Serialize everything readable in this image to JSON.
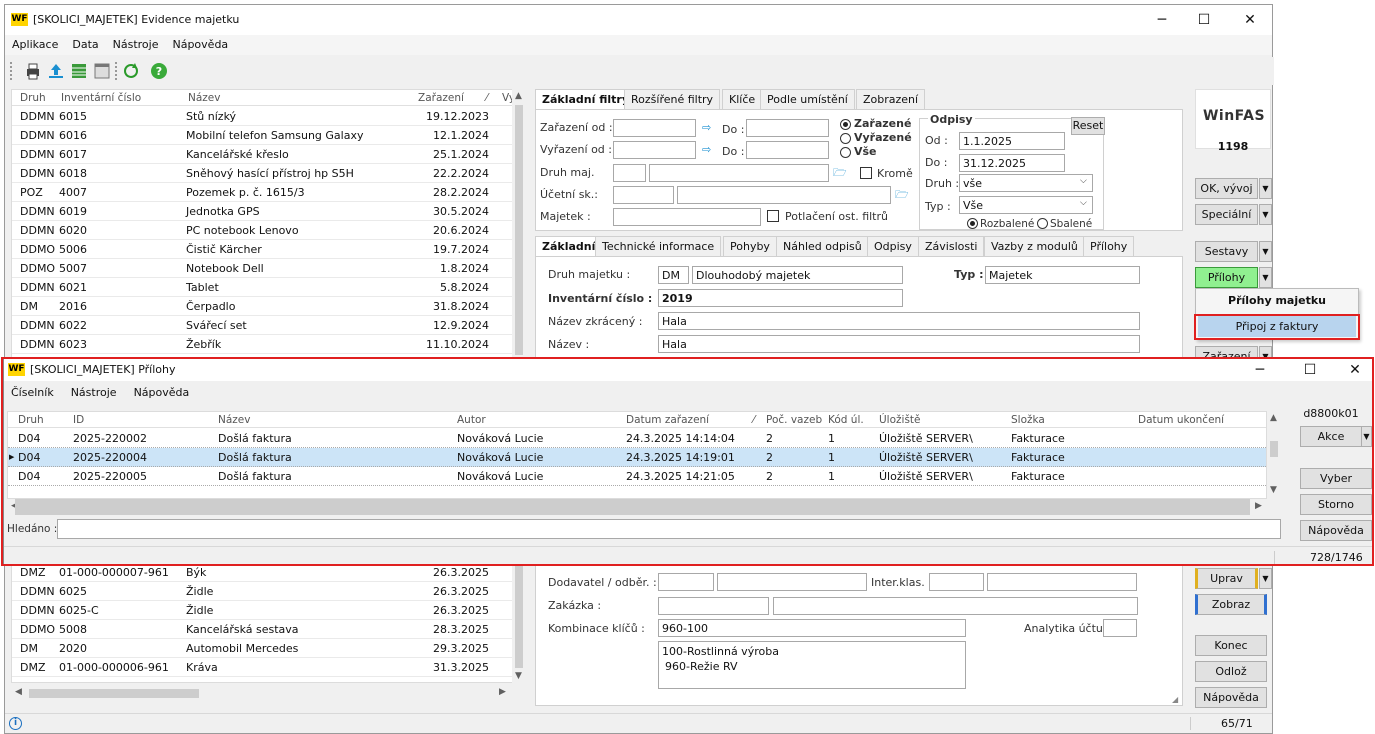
{
  "main": {
    "title": "[SKOLICI_MAJETEK] Evidence majetku",
    "logo_text": "WF",
    "menu": [
      "Aplikace",
      "Data",
      "Nástroje",
      "Nápověda"
    ],
    "grid": {
      "headers": [
        "Druh",
        "Inventární číslo",
        "Název",
        "Zařazení",
        "Vy"
      ],
      "rows_top": [
        [
          "DDMN",
          "6015",
          "Stů nízký",
          "19.12.2023"
        ],
        [
          "DDMN",
          "6016",
          "Mobilní telefon Samsung Galaxy",
          "12.1.2024"
        ],
        [
          "DDMN",
          "6017",
          "Kancelářské křeslo",
          "25.1.2024"
        ],
        [
          "DDMN",
          "6018",
          "Sněhový hasící přístroj hp S5H",
          "22.2.2024"
        ],
        [
          "POZ",
          "4007",
          "Pozemek p. č. 1615/3",
          "28.2.2024"
        ],
        [
          "DDMN",
          "6019",
          "Jednotka GPS",
          "30.5.2024"
        ],
        [
          "DDMN",
          "6020",
          "PC notebook Lenovo",
          "20.6.2024"
        ],
        [
          "DDMO",
          "5006",
          "Čistič Kärcher",
          "19.7.2024"
        ],
        [
          "DDMO",
          "5007",
          "Notebook Dell",
          "1.8.2024"
        ],
        [
          "DDMN",
          "6021",
          "Tablet",
          "5.8.2024"
        ],
        [
          "DM",
          "2016",
          "Čerpadlo",
          "31.8.2024"
        ],
        [
          "DDMN",
          "6022",
          "Svářecí set",
          "12.9.2024"
        ],
        [
          "DDMN",
          "6023",
          "Žebřík",
          "11.10.2024"
        ]
      ],
      "rows_bottom": [
        [
          "DMZ",
          "01-000-000007-961",
          "Býk",
          "26.3.2025"
        ],
        [
          "DDMN",
          "6025",
          "Židle",
          "26.3.2025"
        ],
        [
          "DDMN",
          "6025-C",
          "Židle",
          "26.3.2025"
        ],
        [
          "DDMO",
          "5008",
          "Kancelářská sestava",
          "28.3.2025"
        ],
        [
          "DM",
          "2020",
          "Automobil Mercedes",
          "29.3.2025"
        ],
        [
          "DMZ",
          "01-000-000006-961",
          "Kráva",
          "31.3.2025"
        ]
      ]
    },
    "filter_tabs": [
      "Základní filtry",
      "Rozšířené filtry",
      "Klíče",
      "Podle umístění",
      "Zobrazení"
    ],
    "filters": {
      "zarazeni_od": "Zařazení od :",
      "vyrazeni_od": "Vyřazení od :",
      "do": "Do :",
      "druh_maj": "Druh maj.",
      "ucetni_sk": "Účetní sk.:",
      "majetek": "Majetek :",
      "radio": [
        "Zařazené",
        "Vyřazené",
        "Vše"
      ],
      "krome": "Kromě",
      "potlaceni": "Potlačení ost. filtrů",
      "odpisy_title": "Odpisy",
      "od_label": "Od :",
      "od_value": "1.1.2025",
      "do_label": "Do :",
      "do_value": "31.12.2025",
      "druh_label": "Druh :",
      "druh_value": "vše",
      "typ_label": "Typ :",
      "typ_value": "Vše",
      "reset": "Reset",
      "rozbalene": "Rozbalené",
      "sbalene": "Sbalené"
    },
    "detail_tabs": [
      "Základní",
      "Technické informace",
      "Pohyby",
      "Náhled odpisů",
      "Odpisy",
      "Závislosti",
      "Vazby z modulů",
      "Přílohy"
    ],
    "detail": {
      "druh_label": "Druh majetku :",
      "druh_code": "DM",
      "druh_name": "Dlouhodobý majetek",
      "typ_label": "Typ :",
      "typ_value": "Majetek",
      "inv_label": "Inventární číslo :",
      "inv_value": "2019",
      "nazev_zkr_label": "Název zkrácený :",
      "nazev_zkr_value": "Hala",
      "nazev_label": "Název :",
      "nazev_value": "Hala",
      "dodavatel_label": "Dodavatel / odběr. :",
      "interklas_label": "Inter.klas. :",
      "zakazka_label": "Zakázka :",
      "kombinace_label": "Kombinace klíčů :",
      "kombinace_value": "960-100",
      "kombinace_lines": [
        "100-Rostlinná výroba",
        "960-Režie RV"
      ],
      "analytika_label": "Analytika účtu :"
    },
    "side": {
      "brand": "WinFAS",
      "number": "1198",
      "ok_vyvoj": "OK, vývoj",
      "specialni": "Speciální",
      "sestavy": "Sestavy",
      "prilohy": "Přílohy",
      "zarazeni": "Zařazení",
      "uprav": "Uprav",
      "zobraz": "Zobraz",
      "konec": "Konec",
      "odloz": "Odlož",
      "napoveda": "Nápověda",
      "counter": "65/71"
    },
    "popup": {
      "title": "Přílohy majetku",
      "item": "Připoj z faktury"
    },
    "status_icon": "info-icon"
  },
  "dialog": {
    "title": "[SKOLICI_MAJETEK] Přílohy",
    "menu": [
      "Číselník",
      "Nástroje",
      "Nápověda"
    ],
    "headers": [
      "Druh",
      "ID",
      "Název",
      "Autor",
      "Datum zařazení",
      "Poč. vazeb",
      "Kód úl.",
      "Úložiště",
      "Složka",
      "Datum ukončení"
    ],
    "rows": [
      [
        "D04",
        "2025-220002",
        "Došlá faktura",
        "Nováková Lucie",
        "24.3.2025 14:14:04",
        "2",
        "1",
        "Úložiště SERVER\\",
        "Fakturace",
        ""
      ],
      [
        "D04",
        "2025-220004",
        "Došlá faktura",
        "Nováková Lucie",
        "24.3.2025 14:19:01",
        "2",
        "1",
        "Úložiště SERVER\\",
        "Fakturace",
        ""
      ],
      [
        "D04",
        "2025-220005",
        "Došlá faktura",
        "Nováková Lucie",
        "24.3.2025 14:21:05",
        "2",
        "1",
        "Úložiště SERVER\\",
        "Fakturace",
        ""
      ]
    ],
    "selected_row": 1,
    "search_label": "Hledáno :",
    "side_code": "d8800k01",
    "akce": "Akce",
    "vyber": "Vyber",
    "storno": "Storno",
    "napoveda": "Nápověda",
    "counter": "728/1746"
  },
  "colors": {
    "highlight": "#e02020",
    "selection": "#cce4f7",
    "prilohy_btn": "#90f090",
    "popup_item": "#b8d4ee"
  }
}
